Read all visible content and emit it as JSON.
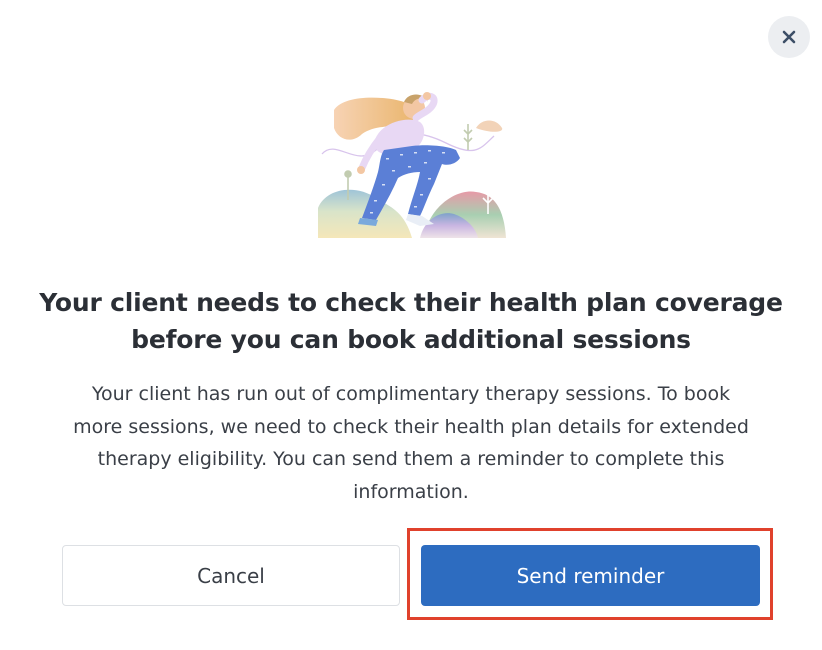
{
  "dialog": {
    "close_icon": "close-icon",
    "illustration": "woman-hiking-illustration",
    "title": "Your client needs to check their health plan coverage before you can book additional sessions",
    "body": "Your client has run out of complimentary therapy sessions. To book more sessions, we need to check their health plan details for extended therapy eligibility. You can send them a reminder to complete this information.",
    "cancel_label": "Cancel",
    "send_label": "Send reminder"
  },
  "colors": {
    "primary": "#2d6cc0",
    "highlight": "#e0412c",
    "close_bg": "#eceef1",
    "text": "#2b2f36"
  }
}
